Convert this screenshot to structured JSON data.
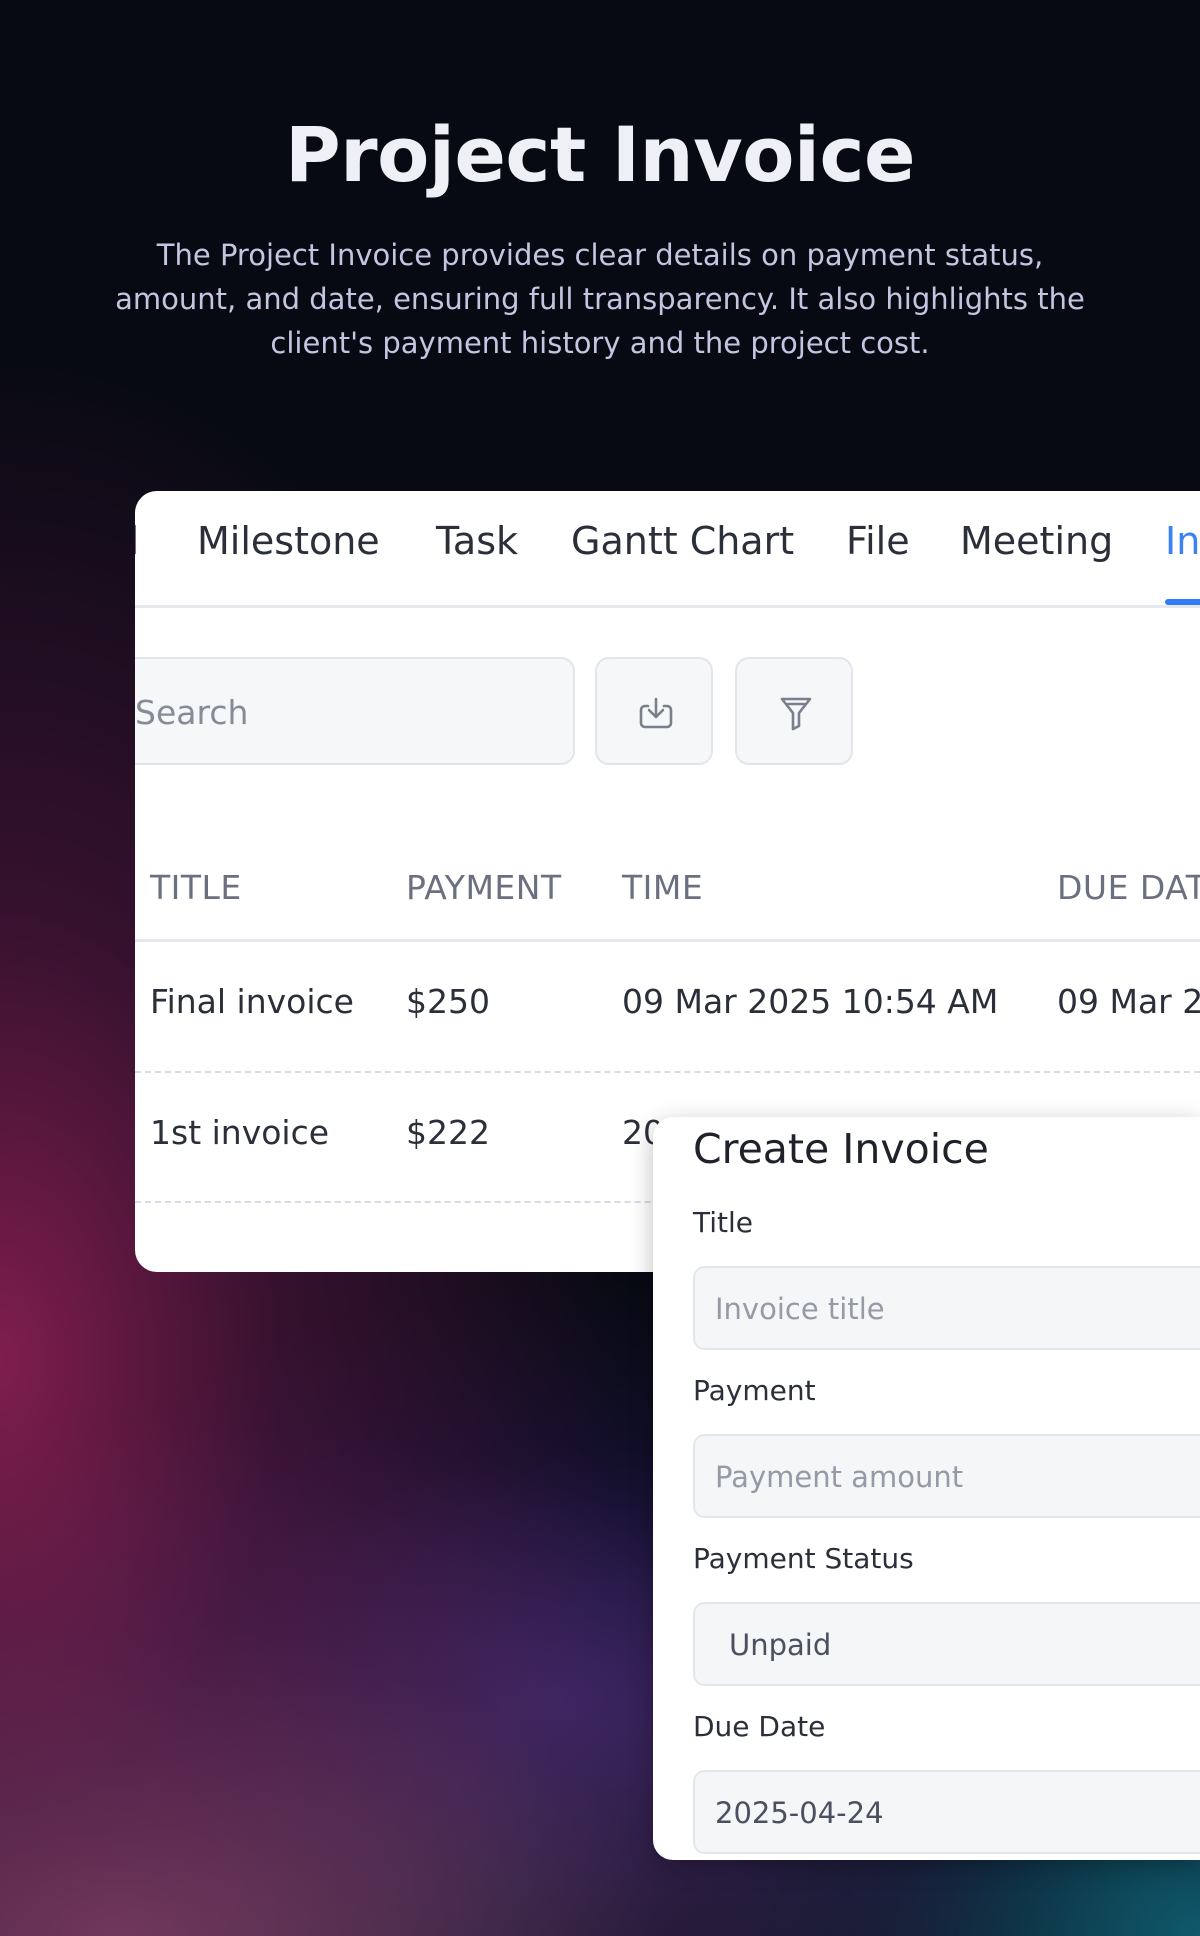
{
  "hero": {
    "title": "Project Invoice",
    "description": "The Project Invoice provides clear details on payment status, amount, and date, ensuring full transparency. It also highlights the client's payment history and the project cost."
  },
  "tabs": [
    {
      "label": "d"
    },
    {
      "label": "Milestone"
    },
    {
      "label": "Task"
    },
    {
      "label": "Gantt Chart"
    },
    {
      "label": "File"
    },
    {
      "label": "Meeting"
    },
    {
      "label": "In",
      "active": true
    }
  ],
  "toolbar": {
    "search_placeholder": "Search",
    "download_icon": "download-icon",
    "filter_icon": "filter-icon"
  },
  "table": {
    "headers": [
      "TITLE",
      "PAYMENT",
      "TIME",
      "DUE DAT"
    ],
    "rows": [
      {
        "title": "Final invoice",
        "payment": "$250",
        "time": "09 Mar 2025 10:54 AM",
        "due": "09 Mar 2"
      },
      {
        "title": "1st invoice",
        "payment": "$222",
        "time": "20"
      }
    ]
  },
  "modal": {
    "title": "Create Invoice",
    "fields": [
      {
        "label": "Title",
        "placeholder": "Invoice title"
      },
      {
        "label": "Payment",
        "placeholder": "Payment amount"
      },
      {
        "label": "Payment Status",
        "value": "Unpaid"
      },
      {
        "label": "Due Date",
        "value": "2025-04-24"
      }
    ]
  },
  "colors": {
    "background": "#080a13",
    "active_tab": "#3b82f6",
    "card": "#ffffff"
  }
}
